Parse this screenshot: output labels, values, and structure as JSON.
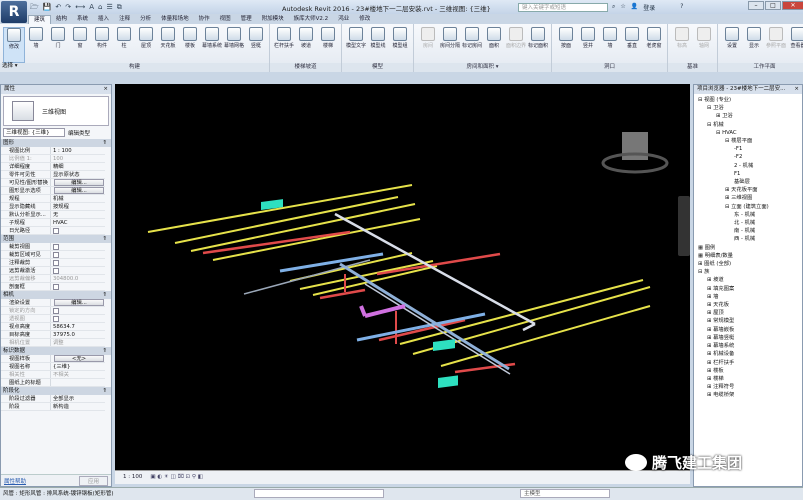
{
  "app": {
    "logo": "R",
    "title": "Autodesk Revit 2016 -   23#楼地下一二层安装.rvt - 三维视图: {三维}",
    "search_placeholder": "键入关键字或短语",
    "login": "登录",
    "help": "?"
  },
  "quick_access": [
    "open-icon",
    "save-icon",
    "undo-icon",
    "redo-icon",
    "measure-icon",
    "text-icon",
    "3d-view-icon",
    "thin-lines-icon",
    "switch-windows-icon"
  ],
  "tabs": [
    {
      "label": "建筑",
      "active": true
    },
    {
      "label": "结构"
    },
    {
      "label": "系统"
    },
    {
      "label": "插入"
    },
    {
      "label": "注释"
    },
    {
      "label": "分析"
    },
    {
      "label": "体量和场地"
    },
    {
      "label": "协作"
    },
    {
      "label": "视图"
    },
    {
      "label": "管理"
    },
    {
      "label": "附加模块"
    },
    {
      "label": "族库大师V2.2"
    },
    {
      "label": "鸿业"
    },
    {
      "label": "修改"
    }
  ],
  "ribbon": {
    "select_label": "选择 ▾",
    "panels": [
      {
        "label": "构建",
        "buttons": [
          {
            "label": "修改",
            "selected": true
          },
          {
            "label": "墙"
          },
          {
            "label": "门"
          },
          {
            "label": "窗"
          },
          {
            "label": "构件"
          },
          {
            "label": "柱"
          },
          {
            "label": "屋顶"
          },
          {
            "label": "天花板"
          },
          {
            "label": "楼板"
          },
          {
            "label": "幕墙系统"
          },
          {
            "label": "幕墙网格"
          },
          {
            "label": "竖梃"
          }
        ]
      },
      {
        "label": "楼梯坡道",
        "buttons": [
          {
            "label": "栏杆扶手"
          },
          {
            "label": "坡道"
          },
          {
            "label": "楼梯"
          }
        ]
      },
      {
        "label": "模型",
        "buttons": [
          {
            "label": "模型文字"
          },
          {
            "label": "模型线"
          },
          {
            "label": "模型组"
          }
        ]
      },
      {
        "label": "房间和面积 ▾",
        "buttons": [
          {
            "label": "房间",
            "disabled": true
          },
          {
            "label": "房间分隔"
          },
          {
            "label": "标记房间"
          },
          {
            "label": "面积"
          },
          {
            "label": "面积边界",
            "disabled": true
          },
          {
            "label": "标记面积"
          }
        ]
      },
      {
        "label": "洞口",
        "buttons": [
          {
            "label": "按面"
          },
          {
            "label": "竖井"
          },
          {
            "label": "墙"
          },
          {
            "label": "垂直"
          },
          {
            "label": "老虎窗"
          }
        ]
      },
      {
        "label": "基准",
        "buttons": [
          {
            "label": "标高",
            "disabled": true
          },
          {
            "label": "轴网",
            "disabled": true
          }
        ]
      },
      {
        "label": "工作平面",
        "buttons": [
          {
            "label": "设置"
          },
          {
            "label": "显示"
          },
          {
            "label": "参照平面",
            "disabled": true
          },
          {
            "label": "查看器"
          }
        ]
      }
    ]
  },
  "properties": {
    "title": "属性",
    "close": "×",
    "type_name": "三维视图",
    "selector": "三维视图: {三维}",
    "edit_type": "编辑类型",
    "sections": [
      {
        "label": "图形",
        "rows": [
          {
            "k": "视图比例",
            "v": "1 : 100"
          },
          {
            "k": "比例值 1:",
            "v": "100",
            "dim": true
          },
          {
            "k": "详细程度",
            "v": "精细"
          },
          {
            "k": "零件可见性",
            "v": "显示原状态"
          },
          {
            "k": "可见性/图形替换",
            "v": "编辑...",
            "button": true
          },
          {
            "k": "图形显示选项",
            "v": "编辑...",
            "button": true
          },
          {
            "k": "规程",
            "v": "机械"
          },
          {
            "k": "显示隐藏线",
            "v": "按规程"
          },
          {
            "k": "默认分析显示...",
            "v": "无"
          },
          {
            "k": "子规程",
            "v": "HVAC"
          },
          {
            "k": "日光路径",
            "check": true
          }
        ]
      },
      {
        "label": "范围",
        "rows": [
          {
            "k": "裁剪视图",
            "check": true
          },
          {
            "k": "裁剪区域可见",
            "check": true
          },
          {
            "k": "注释裁剪",
            "check": true
          },
          {
            "k": "远剪裁激活",
            "check": true
          },
          {
            "k": "远剪裁偏移",
            "v": "304800.0",
            "dim": true
          },
          {
            "k": "剖面框",
            "check": true
          }
        ]
      },
      {
        "label": "相机",
        "rows": [
          {
            "k": "渲染设置",
            "v": "编辑...",
            "button": true
          },
          {
            "k": "锁定的方向",
            "check": true,
            "dim": true
          },
          {
            "k": "透视图",
            "check": true,
            "dim": true
          },
          {
            "k": "视点高度",
            "v": "58634.7"
          },
          {
            "k": "目标高度",
            "v": "37975.0"
          },
          {
            "k": "相机位置",
            "v": "调整",
            "dim": true
          }
        ]
      },
      {
        "label": "标识数据",
        "rows": [
          {
            "k": "视图样板",
            "v": "<无>",
            "button": true
          },
          {
            "k": "视图名称",
            "v": "{三维}"
          },
          {
            "k": "相关性",
            "v": "不相关",
            "dim": true
          },
          {
            "k": "图纸上的标题",
            "v": ""
          }
        ]
      },
      {
        "label": "阶段化",
        "rows": [
          {
            "k": "阶段过滤器",
            "v": "全部显示"
          },
          {
            "k": "阶段",
            "v": "新构造"
          }
        ]
      }
    ],
    "help_link": "属性帮助",
    "apply": "应用"
  },
  "browser": {
    "title": "项目浏览器 - 23#楼地下一二层安...",
    "close": "×",
    "tree": [
      {
        "d": 0,
        "t": "⊟ 视图 (专业)"
      },
      {
        "d": 1,
        "t": "⊟ 卫浴"
      },
      {
        "d": 2,
        "t": "⊞ 卫浴"
      },
      {
        "d": 1,
        "t": "⊟ 机械"
      },
      {
        "d": 2,
        "t": "⊟ HVAC"
      },
      {
        "d": 3,
        "t": "⊟ 楼层平面"
      },
      {
        "d": 4,
        "t": "-F1"
      },
      {
        "d": 4,
        "t": "-F2"
      },
      {
        "d": 4,
        "t": "2 - 机械"
      },
      {
        "d": 4,
        "t": "F1"
      },
      {
        "d": 4,
        "t": "基础层"
      },
      {
        "d": 3,
        "t": "⊞ 天花板平面"
      },
      {
        "d": 3,
        "t": "⊞ 三维视图"
      },
      {
        "d": 3,
        "t": "⊟ 立面 (建筑立面)"
      },
      {
        "d": 4,
        "t": "东 - 机械"
      },
      {
        "d": 4,
        "t": "北 - 机械"
      },
      {
        "d": 4,
        "t": "南 - 机械"
      },
      {
        "d": 4,
        "t": "西 - 机械"
      },
      {
        "d": 0,
        "t": "▦ 图例"
      },
      {
        "d": 0,
        "t": "▦ 明细表/数量"
      },
      {
        "d": 0,
        "t": "⊞ 图纸 (全部)"
      },
      {
        "d": 0,
        "t": "⊟ 族"
      },
      {
        "d": 1,
        "t": "⊞ 坡道"
      },
      {
        "d": 1,
        "t": "⊞ 填充图案"
      },
      {
        "d": 1,
        "t": "⊞ 墙"
      },
      {
        "d": 1,
        "t": "⊞ 天花板"
      },
      {
        "d": 1,
        "t": "⊞ 屋顶"
      },
      {
        "d": 1,
        "t": "⊞ 常规模型"
      },
      {
        "d": 1,
        "t": "⊞ 幕墙嵌板"
      },
      {
        "d": 1,
        "t": "⊞ 幕墙竖梃"
      },
      {
        "d": 1,
        "t": "⊞ 幕墙系统"
      },
      {
        "d": 1,
        "t": "⊞ 机械设备"
      },
      {
        "d": 1,
        "t": "⊞ 栏杆扶手"
      },
      {
        "d": 1,
        "t": "⊞ 楼板"
      },
      {
        "d": 1,
        "t": "⊞ 楼梯"
      },
      {
        "d": 1,
        "t": "⊞ 注释符号"
      },
      {
        "d": 1,
        "t": "⊞ 电缆桥架"
      }
    ]
  },
  "view_control": {
    "scale": "1 : 100"
  },
  "status": {
    "text": "风管 : 矩形风管 : 排风系统-镀锌钢板(矩形管)",
    "model": "主模型"
  },
  "watermark": "腾飞建工集团",
  "colors": {
    "viewport_bg": "#000000",
    "supply_pipe": "#e6e24a",
    "duct_red": "#e04a4a",
    "duct_blue": "#7fb0e6",
    "duct_magenta": "#d070e0",
    "equipment": "#2ee0c0"
  }
}
